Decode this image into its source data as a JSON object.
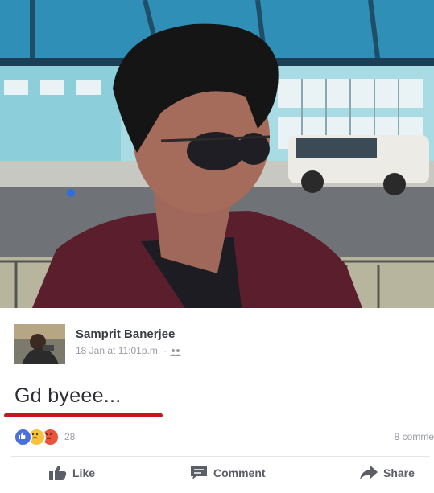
{
  "post": {
    "author": "Samprit Banerjee",
    "timestamp": "18 Jan at 11:01p.m.",
    "separator": "·",
    "privacy_icon": "friends-icon",
    "text": "Gd byeee...",
    "reactions": {
      "icons": [
        "like-reaction-icon",
        "sad-reaction-icon",
        "angry-reaction-icon"
      ],
      "count": "28"
    },
    "comments_count": "8 comme"
  },
  "actions": {
    "like": "Like",
    "comment": "Comment",
    "share": "Share"
  },
  "colors": {
    "underline": "#c4171f",
    "like_blue": "#4a6fe0",
    "text_gray": "#5b5e66"
  }
}
